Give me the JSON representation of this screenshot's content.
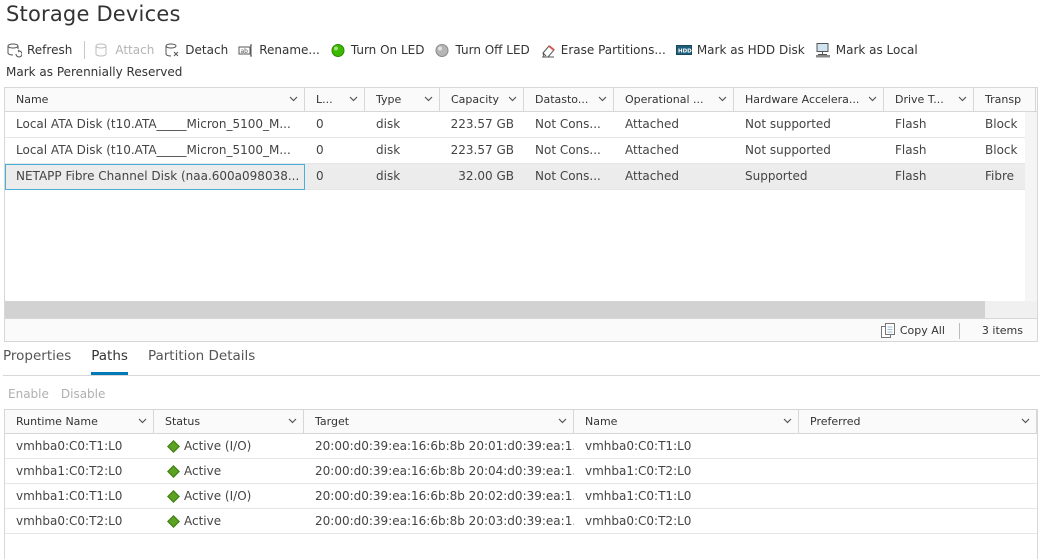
{
  "page": {
    "title": "Storage Devices"
  },
  "toolbar": {
    "refresh": "Refresh",
    "attach": "Attach",
    "detach": "Detach",
    "rename": "Rename...",
    "turn_on_led": "Turn On LED",
    "turn_off_led": "Turn Off LED",
    "erase_partitions": "Erase Partitions...",
    "mark_hdd": "Mark as HDD Disk",
    "mark_local": "Mark as Local",
    "mark_perennially": "Mark as Perennially Reserved"
  },
  "devices": {
    "columns": [
      "Name",
      "L...",
      "Type",
      "Capacity",
      "Datasto...",
      "Operational ...",
      "Hardware Accelera...",
      "Drive T...",
      "Transp"
    ],
    "rows": [
      [
        "Local ATA Disk (t10.ATA_____Micron_5100_M...",
        "0",
        "disk",
        "223.57 GB",
        "Not Cons...",
        "Attached",
        "Not supported",
        "Flash",
        "Block"
      ],
      [
        "Local ATA Disk (t10.ATA_____Micron_5100_M...",
        "0",
        "disk",
        "223.57 GB",
        "Not Cons...",
        "Attached",
        "Not supported",
        "Flash",
        "Block"
      ],
      [
        "NETAPP Fibre Channel Disk (naa.600a098038...",
        "0",
        "disk",
        "32.00 GB",
        "Not Cons...",
        "Attached",
        "Supported",
        "Flash",
        "Fibre"
      ]
    ],
    "copy_all": "Copy All",
    "count": "3 items"
  },
  "tabs": [
    "Properties",
    "Paths",
    "Partition Details"
  ],
  "path_actions": {
    "enable": "Enable",
    "disable": "Disable"
  },
  "paths": {
    "columns": [
      "Runtime Name",
      "Status",
      "Target",
      "Name",
      "Preferred"
    ],
    "rows": [
      [
        "vmhba0:C0:T1:L0",
        "Active (I/O)",
        "20:00:d0:39:ea:16:6b:8b 20:01:d0:39:ea:1...",
        "vmhba0:C0:T1:L0",
        ""
      ],
      [
        "vmhba1:C0:T2:L0",
        "Active",
        "20:00:d0:39:ea:16:6b:8b 20:04:d0:39:ea:1...",
        "vmhba1:C0:T2:L0",
        ""
      ],
      [
        "vmhba1:C0:T1:L0",
        "Active (I/O)",
        "20:00:d0:39:ea:16:6b:8b 20:02:d0:39:ea:1...",
        "vmhba1:C0:T1:L0",
        ""
      ],
      [
        "vmhba0:C0:T2:L0",
        "Active",
        "20:00:d0:39:ea:16:6b:8b 20:03:d0:39:ea:1...",
        "vmhba0:C0:T2:L0",
        ""
      ]
    ]
  },
  "colors": {
    "accent": "#0079b8",
    "status_active": "#5aa220",
    "led_on": "#3cb800"
  }
}
